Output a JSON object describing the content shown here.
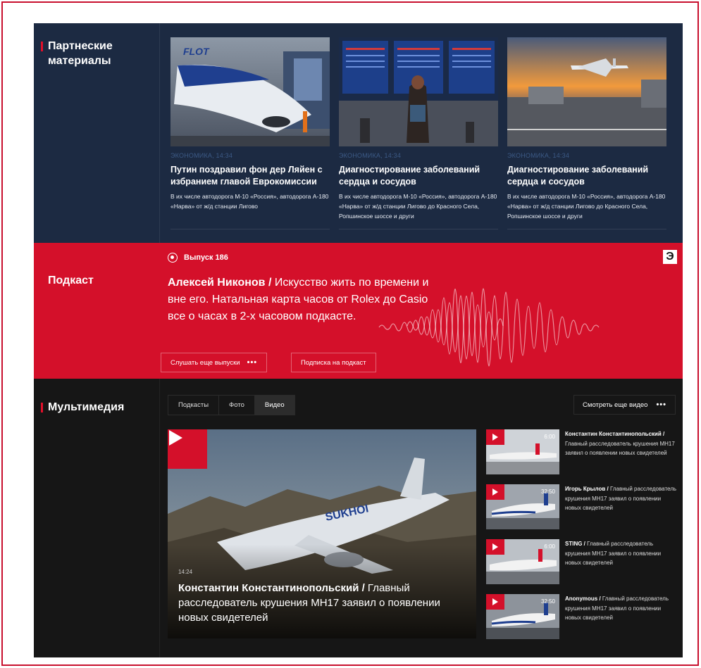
{
  "partners": {
    "title": "Партнеские материалы",
    "cards": [
      {
        "meta": "ЭКОНОМИКА, 14:34",
        "title": "Путин поздравил фон дер Ляйен с избранием главой Еврокомиссии",
        "desc": "В их числе автодорога М-10 «Россия», автодорога А-180 «Нарва» от ж/д станции Лигово"
      },
      {
        "meta": "ЭКОНОМИКА, 14:34",
        "title": "Диагностирование заболеваний сердца и сосудов",
        "desc": "В их числе автодорога М-10 «Россия», автодорога А-180 «Нарва» от ж/д станции Лигово до Красного Села, Ропшинское шоссе и други"
      },
      {
        "meta": "ЭКОНОМИКА, 14:34",
        "title": "Диагностирование заболеваний сердца и сосудов",
        "desc": "В их числе автодорога М-10 «Россия», автодорога А-180 «Нарва» от ж/д станции Лигово до Красного Села, Ропшинское шоссе и други"
      }
    ]
  },
  "podcast": {
    "title": "Подкаст",
    "episode": "Выпуск 186",
    "author": "Алексей Никонов /",
    "text": " Искусство жить по времени и вне его. Натальная карта часов от Rolex до Casio все о часах в 2-х часовом подкасте.",
    "more_label": "Слушать еще выпуски",
    "more_dots": "•••",
    "subscribe_label": "Подписка на подкаст",
    "logo": "Э"
  },
  "multimedia": {
    "title": "Мультимедия",
    "tabs": [
      "Подкасты",
      "Фото",
      "Видео"
    ],
    "active_tab": "Видео",
    "more_label": "Смотреть еще видео",
    "more_dots": "•••",
    "main": {
      "time": "14:24",
      "author": "Константин Константинопольский /",
      "text": " Главный расследователь крушения MH17 заявил о появлении новых свидетелей"
    },
    "videos": [
      {
        "duration": "6:00",
        "author": "Константин Константинопольский /",
        "text": " Главный расследователь крушения MH17 заявил о появлении новых свидетелей"
      },
      {
        "duration": "32:50",
        "author": "Игорь Крылов /",
        "text": " Главный расследователь крушения MH17 заявил о появлении новых свидетелей"
      },
      {
        "duration": "6:00",
        "author": "STING /",
        "text": " Главный расследователь крушения MH17 заявил о появлении новых свидетелей"
      },
      {
        "duration": "32:50",
        "author": "Anonymous /",
        "text": " Главный расследователь крушения MH17 заявил о появлении новых свидетелей"
      }
    ]
  },
  "colors": {
    "accent": "#d4102a",
    "navy": "#1c2a42",
    "dark": "#161616"
  }
}
